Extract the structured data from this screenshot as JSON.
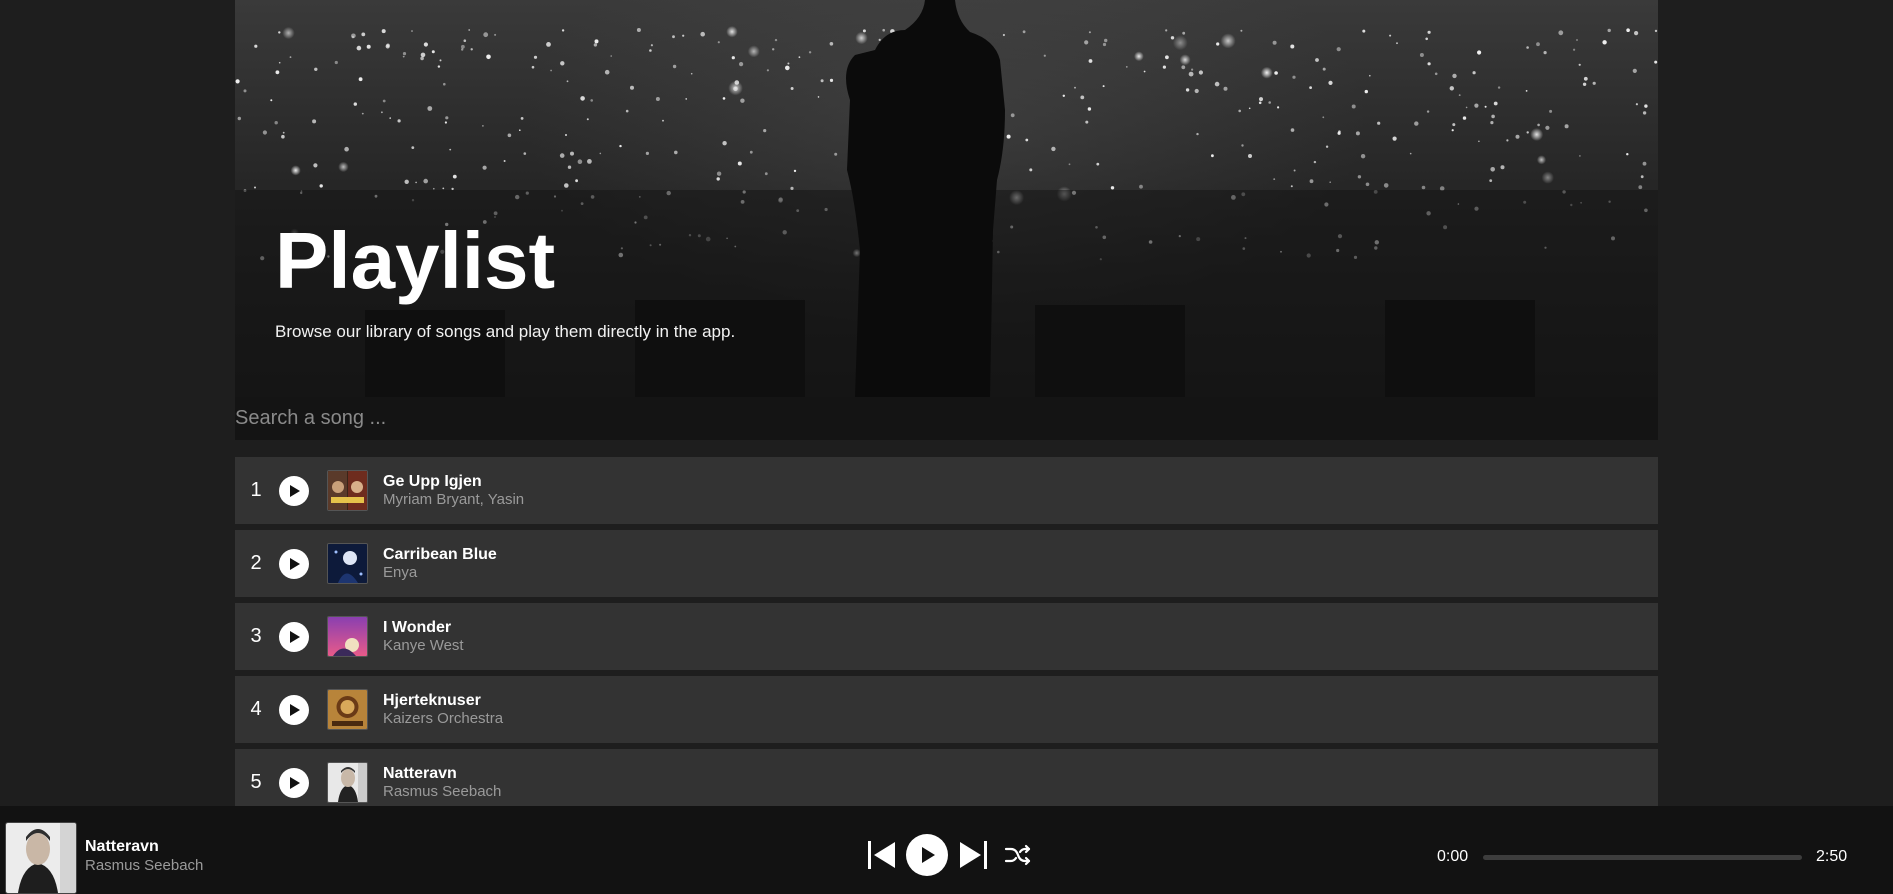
{
  "hero": {
    "title": "Playlist",
    "subtitle": "Browse our library of songs and play them directly in the app."
  },
  "search": {
    "placeholder": "Search a song ...",
    "value": ""
  },
  "songs": [
    {
      "index": "1",
      "title": "Ge Upp Igjen",
      "artist": "Myriam Bryant, Yasin"
    },
    {
      "index": "2",
      "title": "Carribean Blue",
      "artist": "Enya"
    },
    {
      "index": "3",
      "title": "I Wonder",
      "artist": "Kanye West"
    },
    {
      "index": "4",
      "title": "Hjerteknuser",
      "artist": "Kaizers Orchestra"
    },
    {
      "index": "5",
      "title": "Natteravn",
      "artist": "Rasmus Seebach"
    }
  ],
  "player": {
    "title": "Natteravn",
    "artist": "Rasmus Seebach",
    "current_time": "0:00",
    "duration": "2:50",
    "progress": 0
  },
  "icons": {
    "play": "play-icon",
    "previous": "skip-previous-icon",
    "next": "skip-next-icon",
    "shuffle": "shuffle-icon"
  },
  "colors": {
    "background": "#1e1e1e",
    "row": "#333333",
    "player_bar": "#121212",
    "search_bar": "#141414"
  }
}
